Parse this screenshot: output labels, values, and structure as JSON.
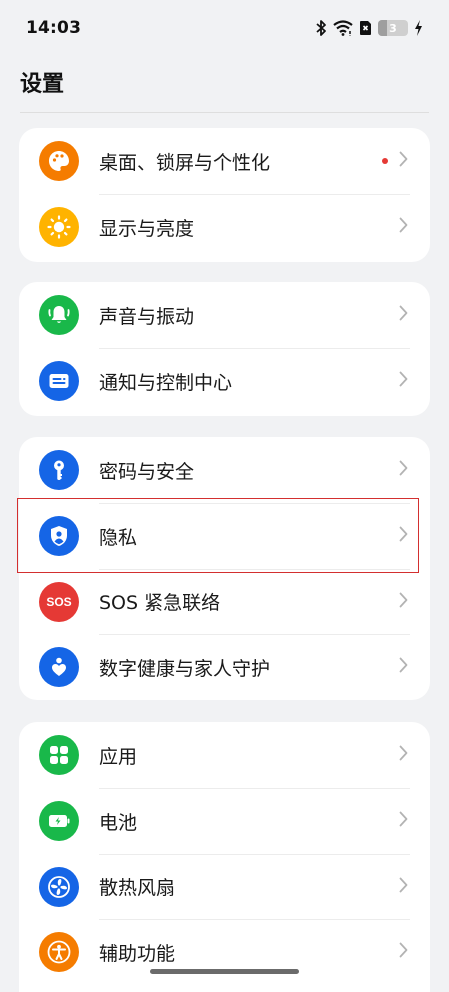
{
  "status_bar": {
    "time": "14:03",
    "battery_level": "3",
    "icons": [
      "bluetooth-icon",
      "wifi-icon",
      "no-sim-icon",
      "battery-icon",
      "charging-icon"
    ]
  },
  "page": {
    "title": "设置"
  },
  "colors": {
    "orange": "#f57c00",
    "yellow": "#ffb300",
    "green": "#19b84a",
    "blue": "#1565e6",
    "red": "#e53935",
    "highlight": "#d32f2f"
  },
  "groups": [
    {
      "items": [
        {
          "label": "桌面、锁屏与个性化",
          "icon": "palette-icon",
          "badge": true
        },
        {
          "label": "显示与亮度",
          "icon": "sun-icon"
        }
      ]
    },
    {
      "items": [
        {
          "label": "声音与振动",
          "icon": "bell-icon"
        },
        {
          "label": "通知与控制中心",
          "icon": "notification-icon"
        }
      ]
    },
    {
      "items": [
        {
          "label": "密码与安全",
          "icon": "key-icon"
        },
        {
          "label": "隐私",
          "icon": "privacy-shield-icon",
          "highlighted": true
        },
        {
          "label": "SOS 紧急联络",
          "icon": "sos-icon",
          "icon_text": "SOS"
        },
        {
          "label": "数字健康与家人守护",
          "icon": "digital-wellbeing-icon"
        }
      ]
    },
    {
      "items": [
        {
          "label": "应用",
          "icon": "apps-icon"
        },
        {
          "label": "电池",
          "icon": "battery-charging-icon"
        },
        {
          "label": "散热风扇",
          "icon": "fan-icon"
        },
        {
          "label": "辅助功能",
          "icon": "accessibility-icon"
        }
      ]
    }
  ]
}
